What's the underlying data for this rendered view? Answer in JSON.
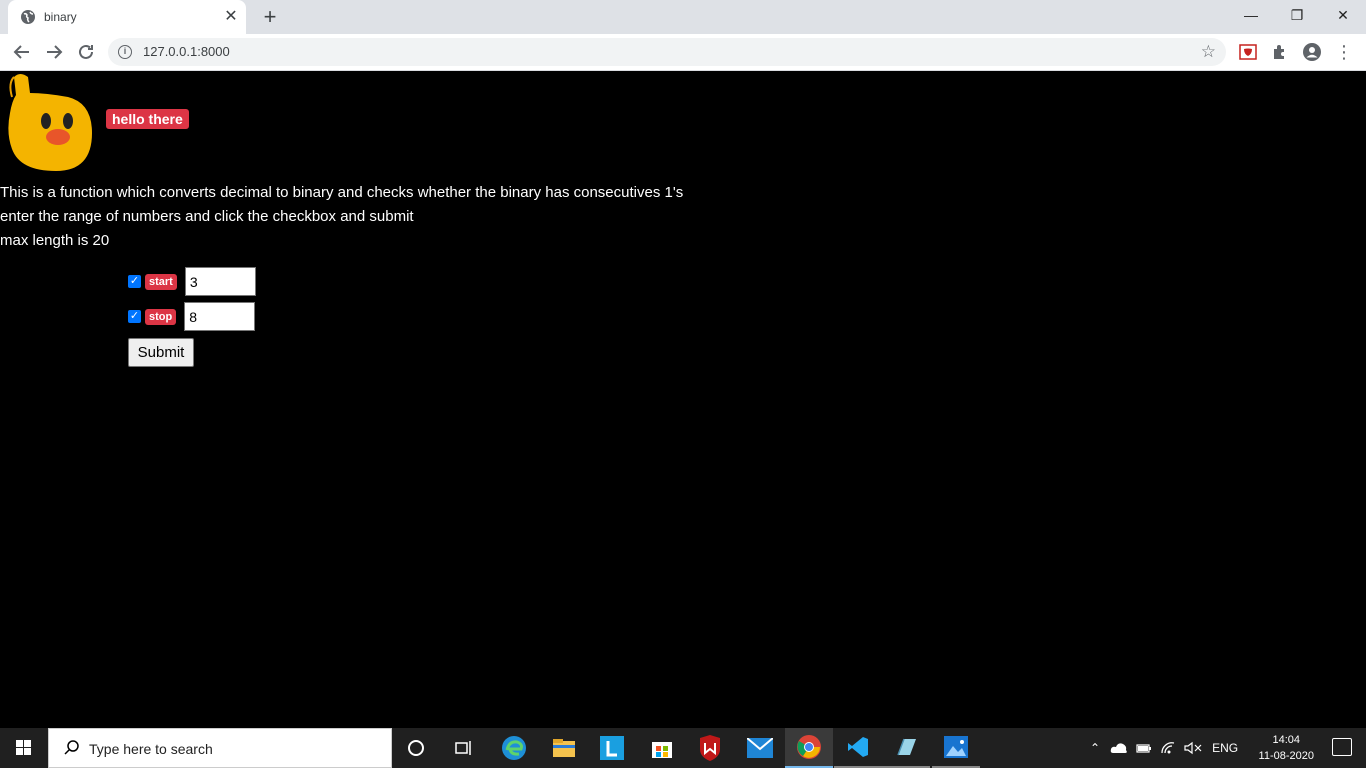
{
  "browser": {
    "tab_title": "binary",
    "url": "127.0.0.1:8000",
    "new_tab_symbol": "+",
    "close_symbol": "✕"
  },
  "page": {
    "badge": "hello there",
    "desc_line1": "This is a function which converts decimal to binary and checks whether the binary has consecutives 1's",
    "desc_line2": "enter the range of numbers and click the checkbox and submit",
    "desc_line3": "max length is 20",
    "start_label": "start",
    "start_value": "3",
    "start_checked": true,
    "stop_label": "stop",
    "stop_value": "8",
    "stop_checked": true,
    "submit_label": "Submit"
  },
  "taskbar": {
    "search_placeholder": "Type here to search",
    "language": "ENG",
    "time": "14:04",
    "date": "11-08-2020"
  },
  "colors": {
    "badge_red": "#dc3545",
    "page_bg": "#000000",
    "checkbox_blue": "#0075ff"
  }
}
